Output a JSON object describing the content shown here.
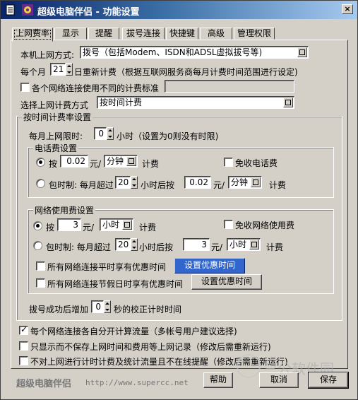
{
  "window": {
    "title": "超级电脑伴侣 - 功能设置",
    "close": "×"
  },
  "tabs": [
    {
      "label": "上网费率",
      "active": true
    },
    {
      "label": "显示"
    },
    {
      "label": "提醒"
    },
    {
      "label": "拔号连接"
    },
    {
      "label": "快捷键"
    },
    {
      "label": "高级"
    },
    {
      "label": "管理权限"
    }
  ],
  "access": {
    "label": "本机上网方式:",
    "value": "拨号（包括Modem、ISDN和ADSL虚拟拔号等)"
  },
  "reset": {
    "prefix": "每个月",
    "day": "21",
    "suffix": "日重新计费（根据互联网服务商每月计费时间范围进行设定)"
  },
  "diff_standard": {
    "label": "各个网络连接使用不同的计费标准",
    "checked": false,
    "value": ""
  },
  "method": {
    "label": "选择上网计费方式",
    "value": "按时间计费"
  },
  "rate_group": {
    "title": "按时间计费率设置",
    "limit_prefix": "每月上网限时:",
    "limit_value": "0",
    "limit_suffix": "小时（设置为0则没有时限)"
  },
  "phone": {
    "title": "电话费设置",
    "per": {
      "prefix": "按",
      "price": "0.02",
      "unit_label": "元/",
      "unit": "分钟",
      "suffix": "计费",
      "checked": true
    },
    "free": {
      "label": "免收电话费",
      "checked": false
    },
    "package": {
      "prefix": "包时制: 每月超过",
      "hours": "20",
      "mid": "小时后按",
      "price": "0.02",
      "unit_label": "元/",
      "unit": "分钟",
      "suffix": "计费",
      "checked": false
    }
  },
  "network": {
    "title": "网络使用费设置",
    "per": {
      "prefix": "按",
      "price": "3",
      "unit_label": "元/",
      "unit": "小时",
      "suffix": "计费",
      "checked": true
    },
    "free": {
      "label": "免收网络使用费",
      "checked": false
    },
    "package": {
      "prefix": "包时制: 每月超过",
      "hours": "20",
      "mid": "小时后按",
      "price": "3",
      "unit_label": "元/",
      "unit": "小时",
      "suffix": "计费",
      "checked": false
    },
    "weekday": {
      "label": "所有网络连接平时享有优惠时间",
      "checked": false,
      "button": "设置优惠时间"
    },
    "holiday": {
      "label": "所有网络连接节假日时享有优惠时间",
      "checked": false,
      "button": "设置优惠时间"
    }
  },
  "dial": {
    "prefix": "拔号成功后增加",
    "value": "0",
    "suffix": "秒的校正计时时间"
  },
  "options": [
    {
      "label": "每个网络连接各自分开计算流量（多帐号用户建议选择)",
      "checked": true
    },
    {
      "label": "只显示而不保存上网时间和费用等上网记录（修改后需重新运行)",
      "checked": false
    },
    {
      "label": "不对上网进行计时计费及统计流量且不在线提醒（修改后需重新运行)",
      "checked": false
    }
  ],
  "footer": {
    "brand": "超级电脑伴侣",
    "url": "http://www.supercc.net",
    "help": "帮助",
    "cancel": "取消",
    "save": "保存",
    "watermark": "三公软件园"
  },
  "colors": {
    "title_start": "#0a246a",
    "title_end": "#a6caf0",
    "face": "#d4d0c8",
    "highlight_btn": "#3366cc"
  }
}
